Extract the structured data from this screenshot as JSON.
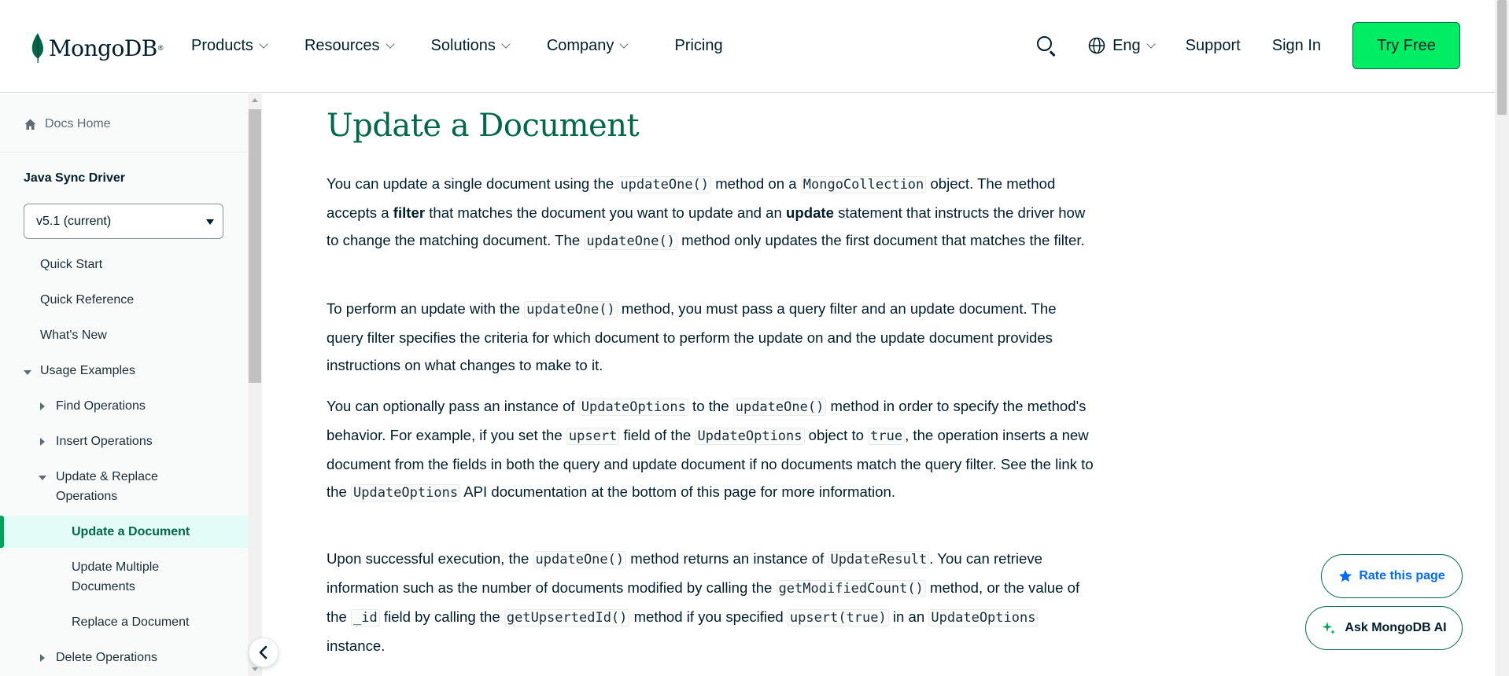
{
  "header": {
    "logo_text": "MongoDB",
    "logo_mark": "®",
    "nav": [
      {
        "label": "Products"
      },
      {
        "label": "Resources"
      },
      {
        "label": "Solutions"
      },
      {
        "label": "Company"
      },
      {
        "label": "Pricing"
      }
    ],
    "language": "Eng",
    "support": "Support",
    "sign_in": "Sign In",
    "try_free": "Try Free"
  },
  "sidebar": {
    "docs_home": "Docs Home",
    "section_title": "Java Sync Driver",
    "version": "v5.1 (current)",
    "items": [
      {
        "label": "Quick Start"
      },
      {
        "label": "Quick Reference"
      },
      {
        "label": "What's New"
      },
      {
        "label": "Usage Examples"
      },
      {
        "label": "Find Operations"
      },
      {
        "label": "Insert Operations"
      },
      {
        "label": "Update & Replace Operations"
      },
      {
        "label": "Update a Document"
      },
      {
        "label": "Update Multiple Documents"
      },
      {
        "label": "Replace a Document"
      },
      {
        "label": "Delete Operations"
      }
    ]
  },
  "main": {
    "title": "Update a Document",
    "p1": {
      "t1": "You can update a single document using the ",
      "c1": "updateOne()",
      "t2": " method on a ",
      "c2": "MongoCollection",
      "t3": " object. The method accepts a ",
      "b1": "filter",
      "t4": " that matches the document you want to update and an ",
      "b2": "update",
      "t5": " statement that instructs the driver how to change the matching document. The ",
      "c3": "updateOne()",
      "t6": " method only updates the first document that matches the filter."
    },
    "p2": {
      "t1": "To perform an update with the ",
      "c1": "updateOne()",
      "t2": " method, you must pass a query filter and an update document. The query filter specifies the criteria for which document to perform the update on and the update document provides instructions on what changes to make to it."
    },
    "p3": {
      "t1": "You can optionally pass an instance of ",
      "c1": "UpdateOptions",
      "t2": " to the ",
      "c2": "updateOne()",
      "t3": " method in order to specify the method's behavior. For example, if you set the ",
      "c3": "upsert",
      "t4": " field of the ",
      "c4": "UpdateOptions",
      "t5": " object to ",
      "c5": "true",
      "t6": ", the operation inserts a new document from the fields in both the query and update document if no documents match the query filter. See the link to the ",
      "c6": "UpdateOptions",
      "t7": " API documentation at the bottom of this page for more information."
    },
    "p4": {
      "t1": "Upon successful execution, the ",
      "c1": "updateOne()",
      "t2": " method returns an instance of ",
      "c2": "UpdateResult",
      "t3": ". You can retrieve information such as the number of documents modified by calling the ",
      "c3": "getModifiedCount()",
      "t4": " method, or the value of the ",
      "c4": "_id",
      "t5": " field by calling the ",
      "c5": "getUpsertedId()",
      "t6": " method if you specified ",
      "c6": "upsert(true)",
      "t7": " in an ",
      "c7": "UpdateOptions",
      "t8": " instance."
    }
  },
  "floating": {
    "rate": "Rate this page",
    "ask": "Ask MongoDB AI"
  },
  "colors": {
    "brand_green": "#00ed64",
    "title_green": "#00684a",
    "active_bg": "#e3fcf7",
    "active_bar": "#00a35c",
    "link_blue": "#016bf8"
  },
  "icons": [
    "mongodb-leaf-icon",
    "chevron-down-icon",
    "search-icon",
    "globe-icon",
    "home-icon",
    "caret-down-icon",
    "triangle-right-icon",
    "triangle-down-icon",
    "chevron-left-icon",
    "star-icon",
    "sparkle-icon"
  ]
}
